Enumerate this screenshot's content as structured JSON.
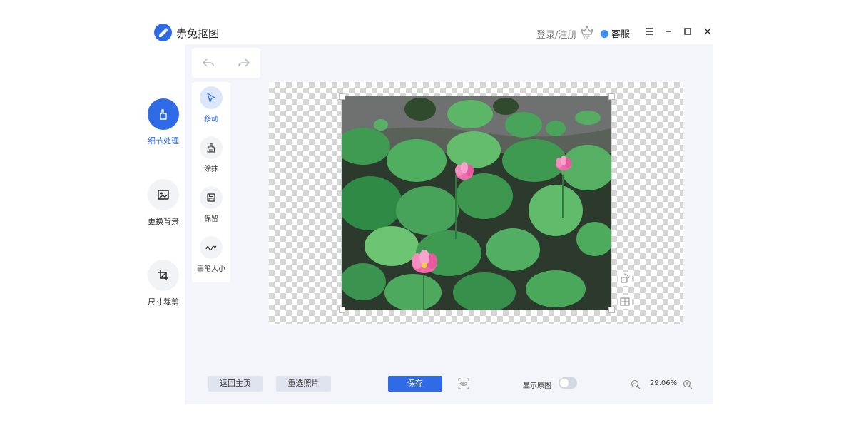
{
  "app": {
    "title": "赤兔抠图"
  },
  "header": {
    "login_label": "登录/注册",
    "vip_icon": "vip-crown-icon",
    "service_label": "客服"
  },
  "nav": {
    "items": [
      {
        "label": "细节处理",
        "icon": "detail-hand-icon",
        "active": true
      },
      {
        "label": "更换背景",
        "icon": "image-icon",
        "active": false
      },
      {
        "label": "尺寸裁剪",
        "icon": "crop-icon",
        "active": false
      }
    ]
  },
  "tools": {
    "items": [
      {
        "label": "移动",
        "icon": "cursor-arrow-icon",
        "active": true
      },
      {
        "label": "涂抹",
        "icon": "brush-icon",
        "active": false
      },
      {
        "label": "保留",
        "icon": "keep-icon",
        "active": false
      },
      {
        "label": "画笔大小",
        "icon": "wave-icon",
        "active": false
      }
    ]
  },
  "bottom": {
    "back_home": "返回主页",
    "reselect": "重选照片",
    "save": "保存",
    "show_original": "显示原图",
    "show_original_on": false,
    "zoom": "29.06%"
  },
  "colors": {
    "accent": "#2f6be6",
    "panel_bg": "#f3f5fa",
    "nav_circle": "#f1f3f7"
  }
}
